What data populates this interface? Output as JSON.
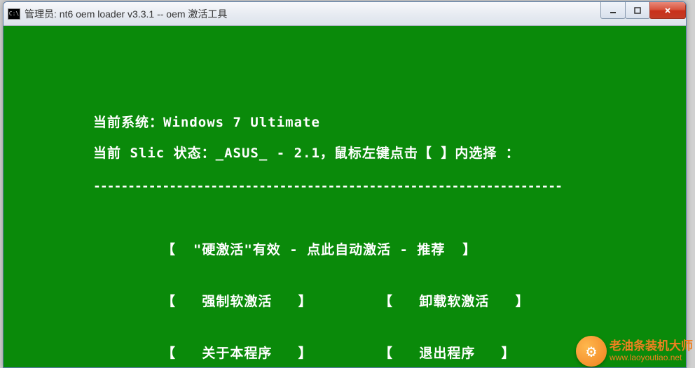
{
  "window": {
    "icon_text": "C:\\",
    "title": "管理员: nt6 oem loader v3.3.1  -- oem 激活工具"
  },
  "console": {
    "system_label": "当前系统：",
    "system_value": "Windows 7 Ultimate",
    "slic_label_prefix": "当前 Slic 状态：",
    "slic_value": "_ASUS_ - 2.1",
    "slic_hint": "，鼠标左键点击【 】内选择 ：",
    "divider": "--------------------------------------------------------------------",
    "options": {
      "recommend": "【  \"硬激活\"有效 - 点此自动激活 - 推荐  】",
      "force": "【   强制软激活   】",
      "uninstall": "【   卸载软激活   】",
      "about": "【   关于本程序   】",
      "exit": "【   退出程序   】"
    }
  },
  "watermark": {
    "title": "老油条装机大师",
    "url": "www.laoyoutiao.net"
  }
}
